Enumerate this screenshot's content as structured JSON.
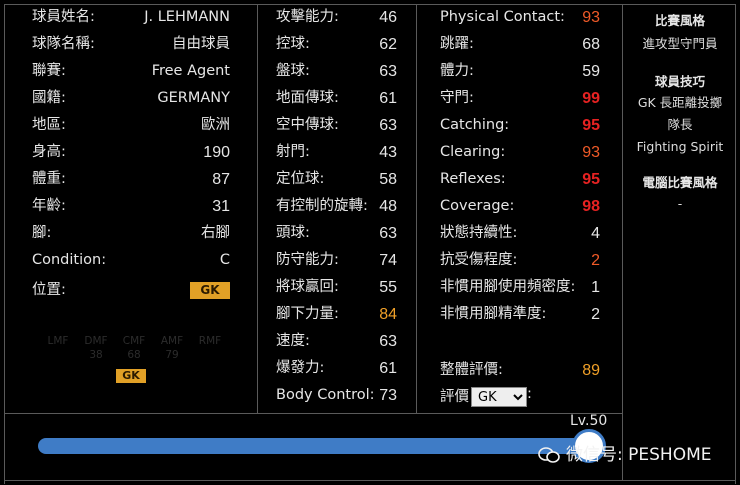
{
  "profile": {
    "rows": [
      {
        "label": "球員姓名:",
        "value": "J. LEHMANN"
      },
      {
        "label": "球隊名稱:",
        "value": "自由球員"
      },
      {
        "label": "聯賽:",
        "value": "Free Agent"
      },
      {
        "label": "國籍:",
        "value": "GERMANY"
      },
      {
        "label": "地區:",
        "value": "歐洲"
      },
      {
        "label": "身高:",
        "value": "190"
      },
      {
        "label": "體重:",
        "value": "87"
      },
      {
        "label": "年齡:",
        "value": "31"
      },
      {
        "label": "腳:",
        "value": "右腳"
      },
      {
        "label": "Condition:",
        "value": "C"
      }
    ],
    "position_label": "位置:",
    "position_value": "GK",
    "position_map": {
      "labels": [
        "LMF",
        "DMF",
        "CMF",
        "AMF",
        "RMF"
      ],
      "numbers": [
        "",
        "38",
        "68",
        "79",
        ""
      ],
      "active": "GK"
    }
  },
  "attributes_left": [
    {
      "label": "攻擊能力:",
      "value": "46"
    },
    {
      "label": "控球:",
      "value": "62"
    },
    {
      "label": "盤球:",
      "value": "63"
    },
    {
      "label": "地面傳球:",
      "value": "61"
    },
    {
      "label": "空中傳球:",
      "value": "63"
    },
    {
      "label": "射門:",
      "value": "43"
    },
    {
      "label": "定位球:",
      "value": "58"
    },
    {
      "label": "有控制的旋轉:",
      "value": "48"
    },
    {
      "label": "頭球:",
      "value": "63"
    },
    {
      "label": "防守能力:",
      "value": "74"
    },
    {
      "label": "將球贏回:",
      "value": "55"
    },
    {
      "label": "腳下力量:",
      "value": "84",
      "color": "orange"
    },
    {
      "label": "速度:",
      "value": "63"
    },
    {
      "label": "爆發力:",
      "value": "61"
    },
    {
      "label": "Body Control:",
      "value": "73"
    }
  ],
  "attributes_right": [
    {
      "label": "Physical Contact:",
      "value": "93",
      "color": "redorange"
    },
    {
      "label": "跳躍:",
      "value": "68"
    },
    {
      "label": "體力:",
      "value": "59"
    },
    {
      "label": "守門:",
      "value": "99",
      "color": "red"
    },
    {
      "label": "Catching:",
      "value": "95",
      "color": "red"
    },
    {
      "label": "Clearing:",
      "value": "93",
      "color": "redorange"
    },
    {
      "label": "Reflexes:",
      "value": "95",
      "color": "red"
    },
    {
      "label": "Coverage:",
      "value": "98",
      "color": "red"
    },
    {
      "label": "狀態持續性:",
      "value": "4"
    },
    {
      "label": "抗受傷程度:",
      "value": "2",
      "color": "redorange"
    },
    {
      "label": "非慣用腳使用頻密度:",
      "value": "1"
    },
    {
      "label": "非慣用腳精準度:",
      "value": "2"
    }
  ],
  "overall": {
    "label": "整體評價:",
    "value": "89"
  },
  "rating": {
    "label": "評價",
    "selected": "GK"
  },
  "side_panel": {
    "style_heading": "比賽風格",
    "style_value": "進攻型守門員",
    "skills_heading": "球員技巧",
    "skills": [
      "GK 長距離投擲",
      "隊長",
      "Fighting Spirit"
    ],
    "ai_heading": "電腦比賽風格",
    "ai_value": "-"
  },
  "level": {
    "label": "Lv.50",
    "progress": 1.0
  },
  "watermark": "微信号: PESHOME",
  "colors": {
    "orange": "#f0a028",
    "red": "#e62222",
    "redorange": "#f05a28",
    "bar": "#3f7cc6",
    "badge": "#e1a026"
  }
}
